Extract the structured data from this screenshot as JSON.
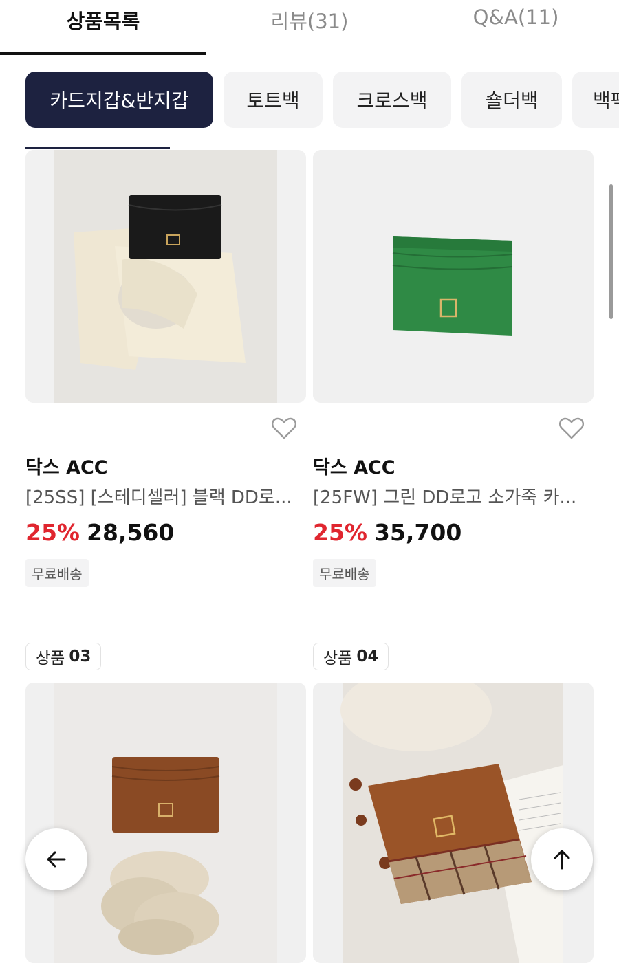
{
  "tabs": [
    {
      "label": "상품목록",
      "active": true
    },
    {
      "label": "리뷰(31)",
      "active": false
    },
    {
      "label": "Q&A(11)",
      "active": false
    }
  ],
  "categories": [
    {
      "label": "카드지갑&반지갑",
      "active": true
    },
    {
      "label": "토트백",
      "active": false
    },
    {
      "label": "크로스백",
      "active": false
    },
    {
      "label": "숄더백",
      "active": false
    },
    {
      "label": "백팩",
      "active": false
    }
  ],
  "products": [
    {
      "brand": "닥스 ACC",
      "name": "[25SS] [스테디셀러] 블랙 DD로...",
      "discount": "25%",
      "price": "28,560",
      "shipping": "무료배송",
      "image": "black-card-wallet"
    },
    {
      "brand": "닥스 ACC",
      "name": "[25FW] 그린 DD로고 소가죽 카...",
      "discount": "25%",
      "price": "35,700",
      "shipping": "무료배송",
      "image": "green-card-wallet"
    },
    {
      "badge_label": "상품",
      "badge_num": "03",
      "image": "brown-card-wallet"
    },
    {
      "badge_label": "상품",
      "badge_num": "04",
      "image": "brown-check-card-wallet"
    }
  ],
  "colors": {
    "accent_navy": "#1d2240",
    "discount_red": "#e0262f"
  },
  "icons": {
    "heart": "heart-outline-icon",
    "back": "arrow-left-icon",
    "top": "arrow-up-icon"
  }
}
